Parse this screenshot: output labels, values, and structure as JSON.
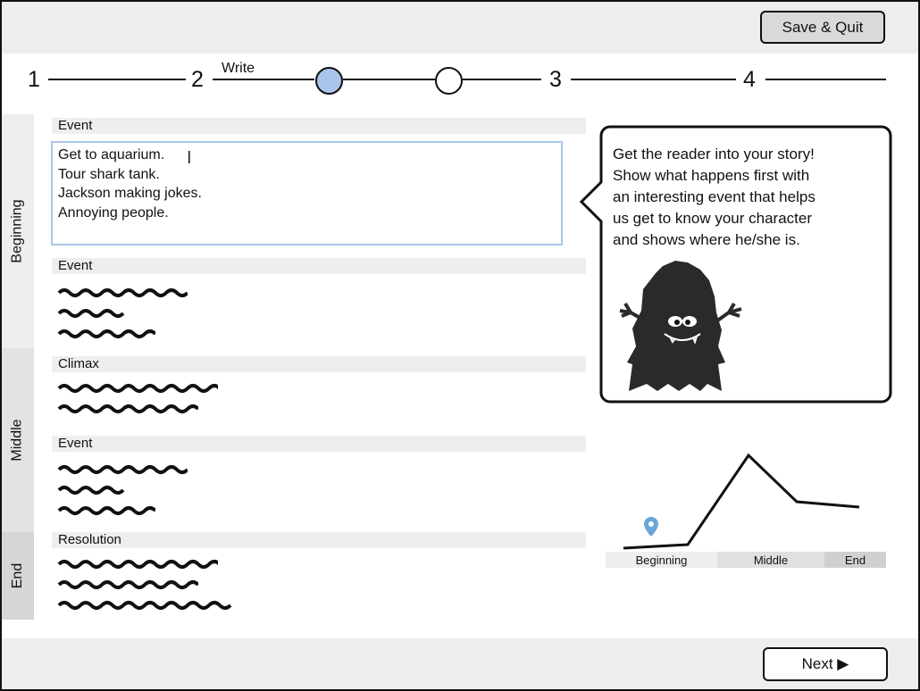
{
  "toolbar": {
    "save_label": "Save & Quit"
  },
  "stepper": {
    "steps": [
      "1",
      "2",
      "3",
      "4"
    ],
    "write_label": "Write",
    "active_color": "#a9c6ea"
  },
  "sidebar": {
    "sections": [
      "Beginning",
      "Middle",
      "End"
    ]
  },
  "editor": {
    "label": "Event",
    "lines": [
      "Get to aquarium.",
      "Tour shark tank.",
      "Jackson making jokes.",
      "Annoying people."
    ]
  },
  "sections": [
    {
      "label": "Event"
    },
    {
      "label": "Climax"
    },
    {
      "label": "Event"
    },
    {
      "label": "Resolution"
    }
  ],
  "tip": {
    "text_lines": [
      "Get the reader into your story!",
      "Show what happens first with",
      "an interesting event that helps",
      "us get to know your character",
      "and shows where he/she is."
    ]
  },
  "story_arc": {
    "segments": [
      "Beginning",
      "Middle",
      "End"
    ],
    "pin_color": "#6aa7d8"
  },
  "footer": {
    "next_label": "Next ▶"
  }
}
